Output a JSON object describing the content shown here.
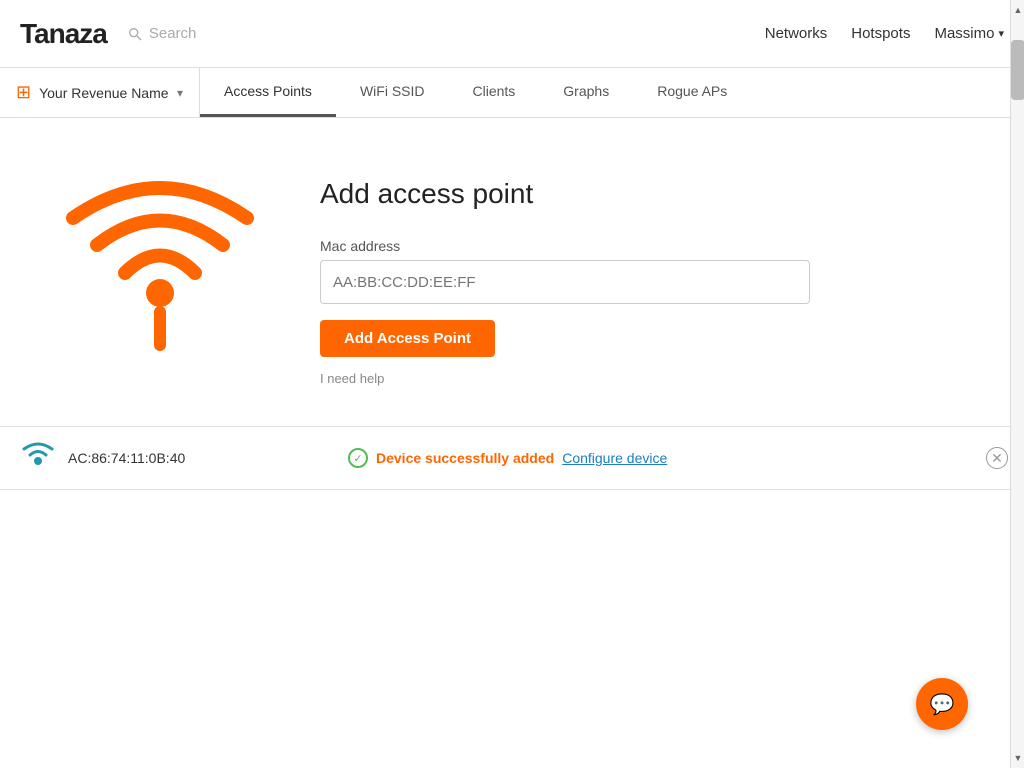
{
  "header": {
    "logo": "Tanaza",
    "search_placeholder": "Search",
    "nav_links": [
      {
        "label": "Networks",
        "id": "networks"
      },
      {
        "label": "Hotspots",
        "id": "hotspots"
      },
      {
        "label": "Massimo",
        "id": "user"
      }
    ]
  },
  "subheader": {
    "network_selector": {
      "label": "Your Revenue Name",
      "icon": "layers"
    },
    "tabs": [
      {
        "label": "Access Points",
        "id": "access-points",
        "active": true
      },
      {
        "label": "WiFi SSID",
        "id": "wifi-ssid",
        "active": false
      },
      {
        "label": "Clients",
        "id": "clients",
        "active": false
      },
      {
        "label": "Graphs",
        "id": "graphs",
        "active": false
      },
      {
        "label": "Rogue APs",
        "id": "rogue-aps",
        "active": false
      }
    ]
  },
  "form": {
    "title": "Add access point",
    "mac_label": "Mac address",
    "mac_placeholder": "AA:BB:CC:DD:EE:FF",
    "add_button_label": "Add Access Point",
    "help_link_label": "I need help"
  },
  "device_row": {
    "mac": "AC:86:74:11:0B:40",
    "status_text": "Device successfully added",
    "configure_link_label": "Configure device"
  },
  "chat_button": {
    "icon": "chat-icon"
  }
}
